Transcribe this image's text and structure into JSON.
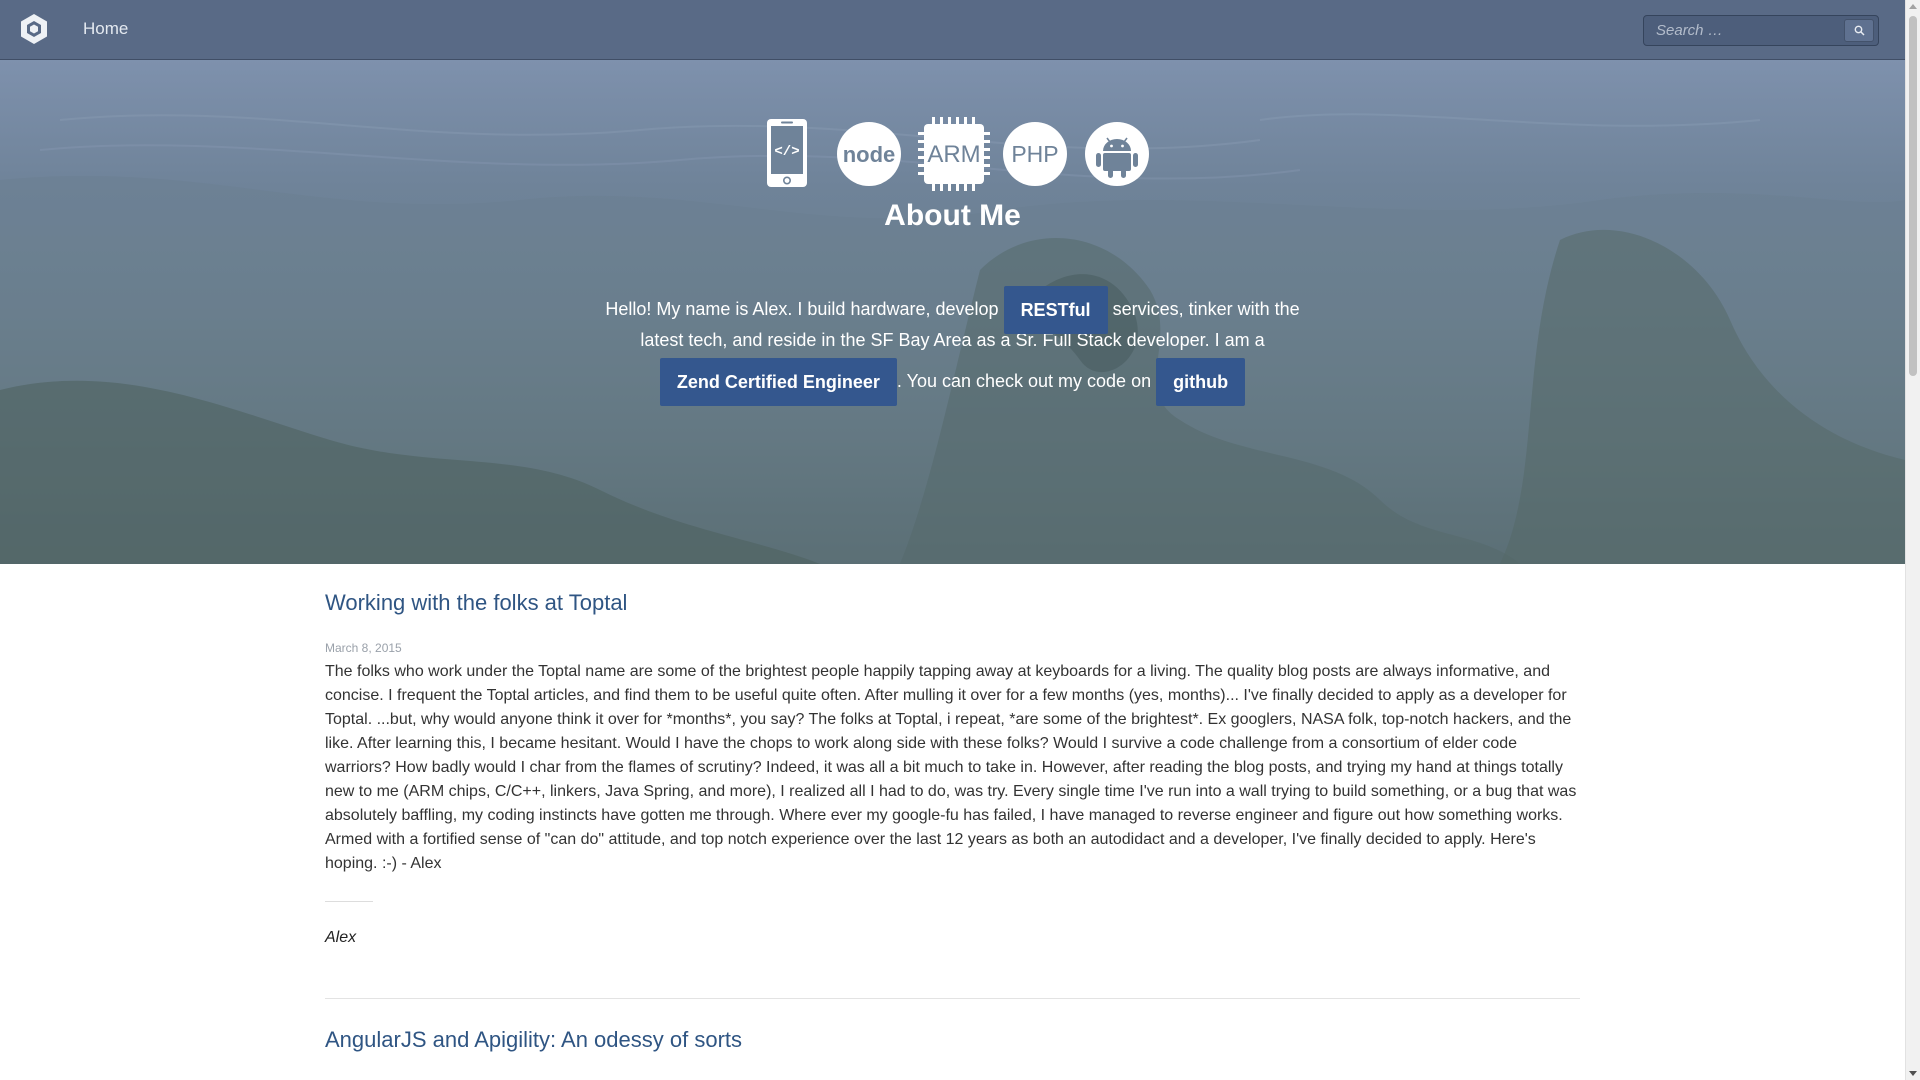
{
  "navbar": {
    "home_label": "Home",
    "search_placeholder": "Search …",
    "logo_icon": "hexagon-logo-icon",
    "search_icon": "magnifier-icon"
  },
  "hero": {
    "title": "About Me",
    "icons": [
      "mobile-code-icon",
      "nodejs-icon",
      "arm-chip-icon",
      "php-icon",
      "android-icon"
    ],
    "icon_texts": {
      "mobile": "</>",
      "node": "node",
      "arm": "ARM",
      "php": "PHP"
    },
    "text_1": "Hello! My name is Alex. I build hardware, develop",
    "restful_label": "RESTful",
    "text_2": "services, tinker with the",
    "text_3": "latest tech, and reside in the SF Bay Area as a Sr. Full Stack developer. I am a",
    "zend_label": "Zend Certified Engineer",
    "text_4": ". You can check out my code on",
    "github_label": "github"
  },
  "posts": [
    {
      "title": "Working with the folks at Toptal",
      "date": "March 8, 2015",
      "body": "The folks who work under the Toptal name are some of the brightest people happily tapping away at keyboards for a living. The quality blog posts are always informative, and concise. I frequent the Toptal articles, and find them to be useful quite often. After mulling it over for a few months (yes, months)... I've finally decided to apply as a developer for Toptal. ...but, why would anyone think it over for *months*, you say? The folks at Toptal, i repeat, *are some of the brightest*. Ex googlers, NASA folk, top-notch hackers, and the like. After learning this, I became hesitant. Would I have the chops to work along side with these folks? Would I survive a code challenge from a consortium of elder code warriors? How badly would I char from the flames of scrutiny? Indeed, it was all a bit much to take in. However, after reading the blog posts, and trying my hand at things totally new to me (ARM chips, C/C++, linkers, Java Spring, and more), I realized all I had to do, was try. Every single time I've run into a wall trying to build something, or a bug that was absolutely baffling, my coding instincts have gotten me through. Where ever my google-fu has failed, I have managed to reverse engineer and figure out how something works. Armed with a fortified sense of \"can do\" attitude, and top notch experience over the last 12 years as both an autodidact and a developer, I've finally decided to apply. Here's hoping. :-) - Alex",
      "signature": "Alex"
    },
    {
      "title": "AngularJS and Apigility: An odessy of sorts"
    }
  ],
  "colors": {
    "navbar": "#596a86",
    "accent_pill": "#34578e",
    "link": "#2f5583"
  }
}
